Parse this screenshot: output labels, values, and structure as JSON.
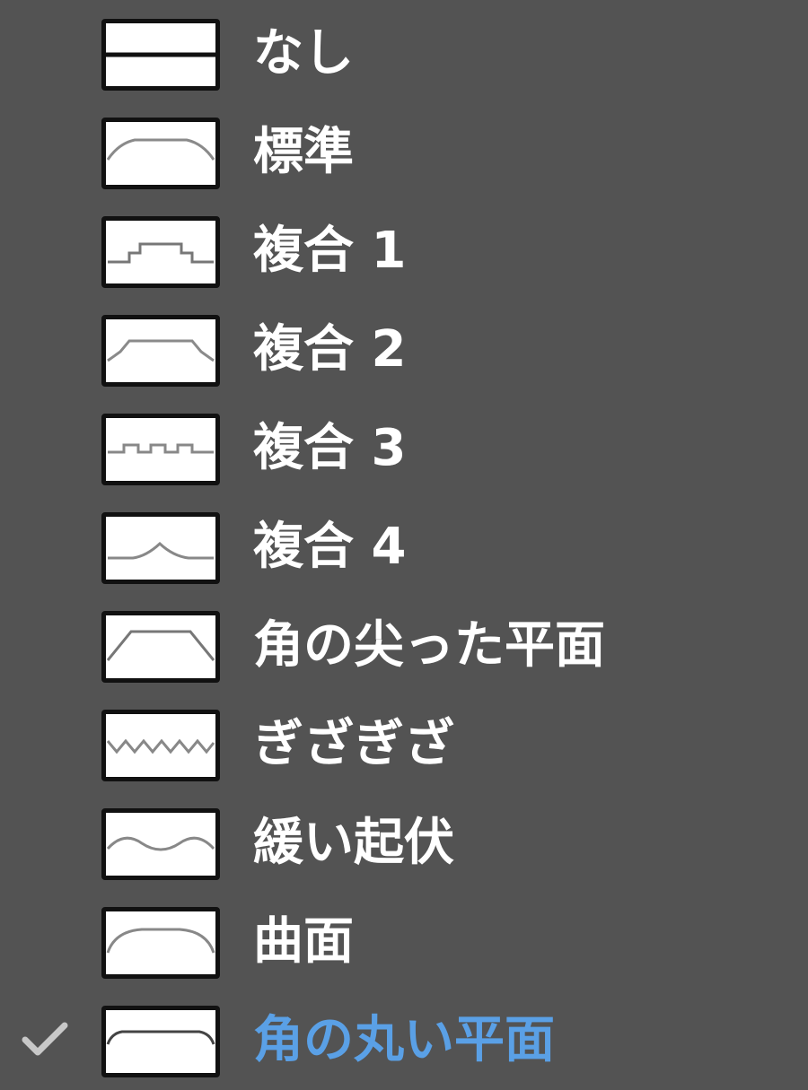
{
  "menu": {
    "accent_color": "#5aa0e6",
    "text_color": "#ffffff",
    "background_color": "#535353",
    "items": [
      {
        "label": "なし",
        "icon": "bevel-none-icon",
        "selected": false
      },
      {
        "label": "標準",
        "icon": "bevel-standard-icon",
        "selected": false
      },
      {
        "label": "複合 1",
        "icon": "bevel-compound-1-icon",
        "selected": false
      },
      {
        "label": "複合 2",
        "icon": "bevel-compound-2-icon",
        "selected": false
      },
      {
        "label": "複合 3",
        "icon": "bevel-compound-3-icon",
        "selected": false
      },
      {
        "label": "複合 4",
        "icon": "bevel-compound-4-icon",
        "selected": false
      },
      {
        "label": "角の尖った平面",
        "icon": "bevel-sharp-flat-icon",
        "selected": false
      },
      {
        "label": "ぎざぎざ",
        "icon": "bevel-jagged-icon",
        "selected": false
      },
      {
        "label": "緩い起伏",
        "icon": "bevel-gentle-undulation-icon",
        "selected": false
      },
      {
        "label": "曲面",
        "icon": "bevel-curved-icon",
        "selected": false
      },
      {
        "label": "角の丸い平面",
        "icon": "bevel-rounded-flat-icon",
        "selected": true
      }
    ]
  }
}
